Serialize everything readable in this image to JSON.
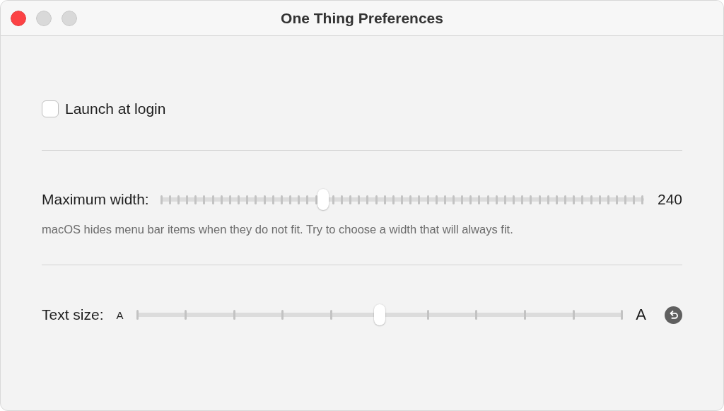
{
  "window": {
    "title": "One Thing Preferences"
  },
  "launch_at_login": {
    "label": "Launch at login",
    "checked": false
  },
  "maximum_width": {
    "label": "Maximum width:",
    "level": 0.337,
    "reading": "240",
    "hint": "macOS hides menu bar items when they do not fit. Try to choose a width that will always fit."
  },
  "text_size": {
    "label": "Text size:",
    "min_label": "A",
    "max_label": "A",
    "level": 0.5
  }
}
